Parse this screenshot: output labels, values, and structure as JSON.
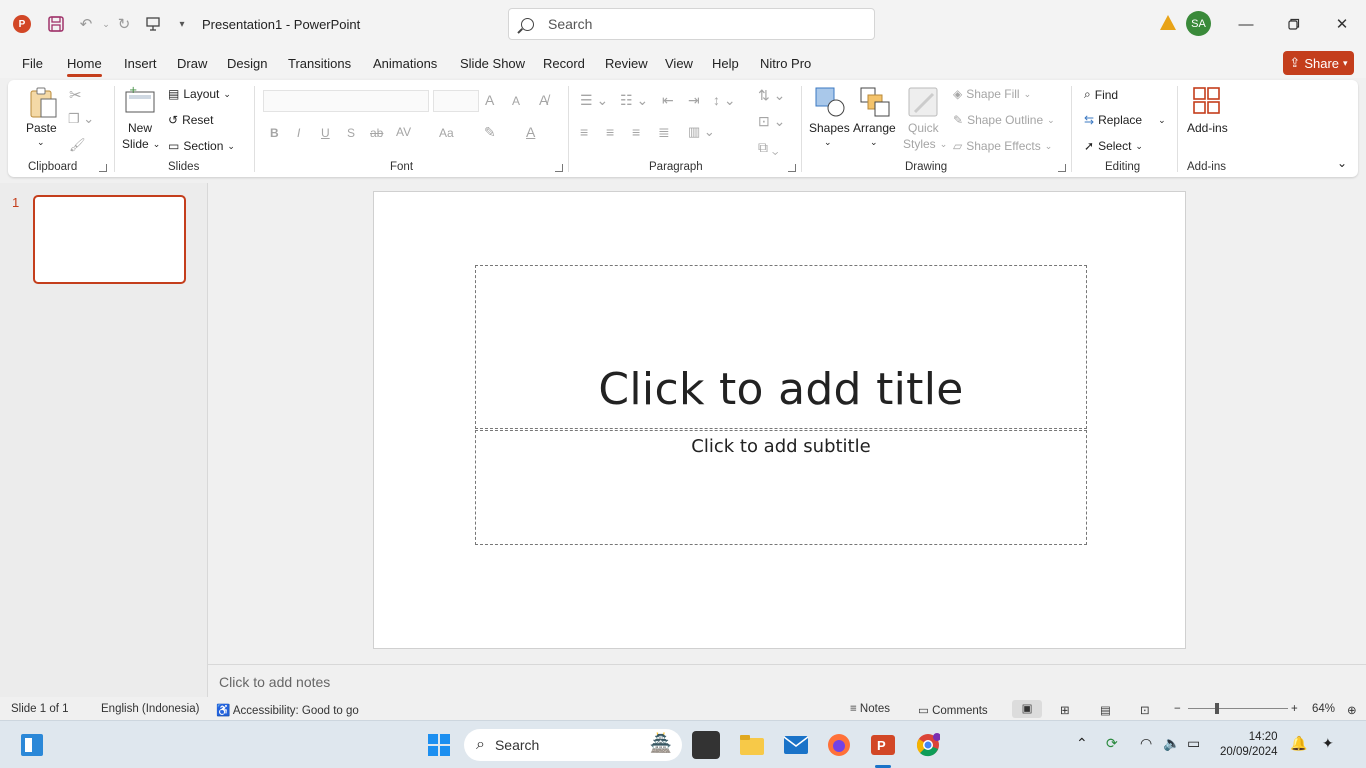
{
  "titlebar": {
    "app_logo": "P",
    "document_title": "Presentation1  -  PowerPoint",
    "search_placeholder": "Search",
    "user_initials": "SA"
  },
  "tabs": [
    "File",
    "Home",
    "Insert",
    "Draw",
    "Design",
    "Transitions",
    "Animations",
    "Slide Show",
    "Record",
    "Review",
    "View",
    "Help",
    "Nitro Pro"
  ],
  "active_tab": "Home",
  "share_label": "Share",
  "ribbon": {
    "clipboard": {
      "label": "Clipboard",
      "paste": "Paste"
    },
    "slides": {
      "label": "Slides",
      "new_slide_1": "New",
      "new_slide_2": "Slide",
      "layout": "Layout",
      "reset": "Reset",
      "section": "Section"
    },
    "font": {
      "label": "Font",
      "bold": "B",
      "italic": "I",
      "underline": "U",
      "strike": "S",
      "abc": "ab",
      "spacing": "AV",
      "case": "Aa",
      "grow": "A",
      "shrink": "A"
    },
    "paragraph": {
      "label": "Paragraph"
    },
    "drawing": {
      "label": "Drawing",
      "shapes": "Shapes",
      "arrange": "Arrange",
      "quick_styles_1": "Quick",
      "quick_styles_2": "Styles",
      "shape_fill": "Shape Fill",
      "shape_outline": "Shape Outline",
      "shape_effects": "Shape Effects"
    },
    "editing": {
      "label": "Editing",
      "find": "Find",
      "replace": "Replace",
      "select": "Select"
    },
    "addins": {
      "label": "Add-ins",
      "addins_btn": "Add-ins"
    }
  },
  "thumbnails": {
    "slide_number": "1"
  },
  "slide": {
    "title_placeholder": "Click to add title",
    "subtitle_placeholder": "Click to add subtitle"
  },
  "notes_placeholder": "Click to add notes",
  "status": {
    "slide_of": "Slide 1 of 1",
    "language": "English (Indonesia)",
    "accessibility": "Accessibility: Good to go",
    "notes": "Notes",
    "comments": "Comments",
    "zoom": "64%"
  },
  "taskbar": {
    "search_label": "Search",
    "time": "14:20",
    "date": "20/09/2024"
  },
  "colors": {
    "accent": "#c43e1c",
    "avatar": "#3a8a3a",
    "warning": "#e8a317"
  }
}
